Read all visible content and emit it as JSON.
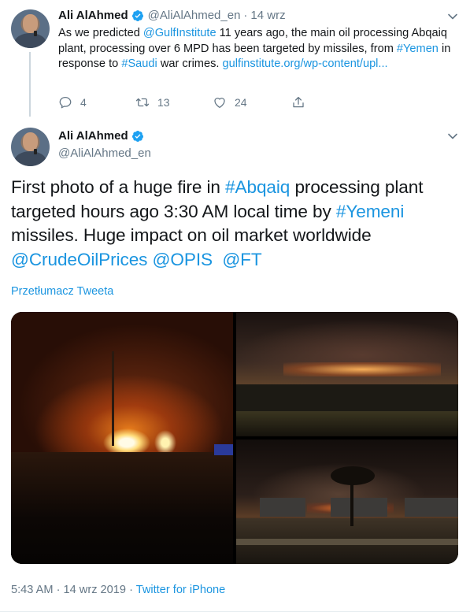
{
  "colors": {
    "accent": "#1b95e0",
    "muted": "#657786",
    "text": "#14171a",
    "verified": "#1da1f2"
  },
  "parent_tweet": {
    "author_name": "Ali AlAhmed",
    "handle": "@AliAlAhmed_en",
    "separator": "·",
    "date": "14 wrz",
    "text_parts": {
      "p1": "As we predicted ",
      "mention_gulf": "@GulfInstitute",
      "p2": " 11 years ago, the main oil processing Abqaiq plant, processing over 6 MPD has been targeted by missiles, from ",
      "tag_yemen": "#Yemen",
      "p3": " in response to ",
      "tag_saudi": "#Saudi",
      "p4": " war crimes. ",
      "url": "gulfinstitute.org/wp-content/upl..."
    },
    "actions": {
      "replies": "4",
      "retweets": "13",
      "likes": "24"
    },
    "icons": [
      "verified-badge-icon",
      "chevron-down-icon",
      "reply-icon",
      "retweet-icon",
      "like-icon",
      "share-icon"
    ]
  },
  "main_tweet": {
    "author_name": "Ali AlAhmed",
    "handle": "@AliAlAhmed_en",
    "text_parts": {
      "p1": "First photo of a huge fire in ",
      "tag_abqaiq": "#Abqaiq",
      "p2": " processing plant targeted hours ago 3:30 AM local time by ",
      "tag_yemeni": "#Yemeni",
      "p3": " missiles. Huge impact on oil market worldwide ",
      "mention_crude": "@CrudeOilPrices",
      "p4": " ",
      "mention_opis": "@OPIS",
      "p5": "  ",
      "mention_ft": "@FT"
    },
    "translate_label": "Przetłumacz Tweeta",
    "photos": [
      "fire-photo-1",
      "fire-photo-2",
      "fire-photo-3"
    ],
    "timestamp": "5:43 AM · 14 wrz 2019",
    "meta_separator": " · ",
    "source": "Twitter for iPhone"
  }
}
